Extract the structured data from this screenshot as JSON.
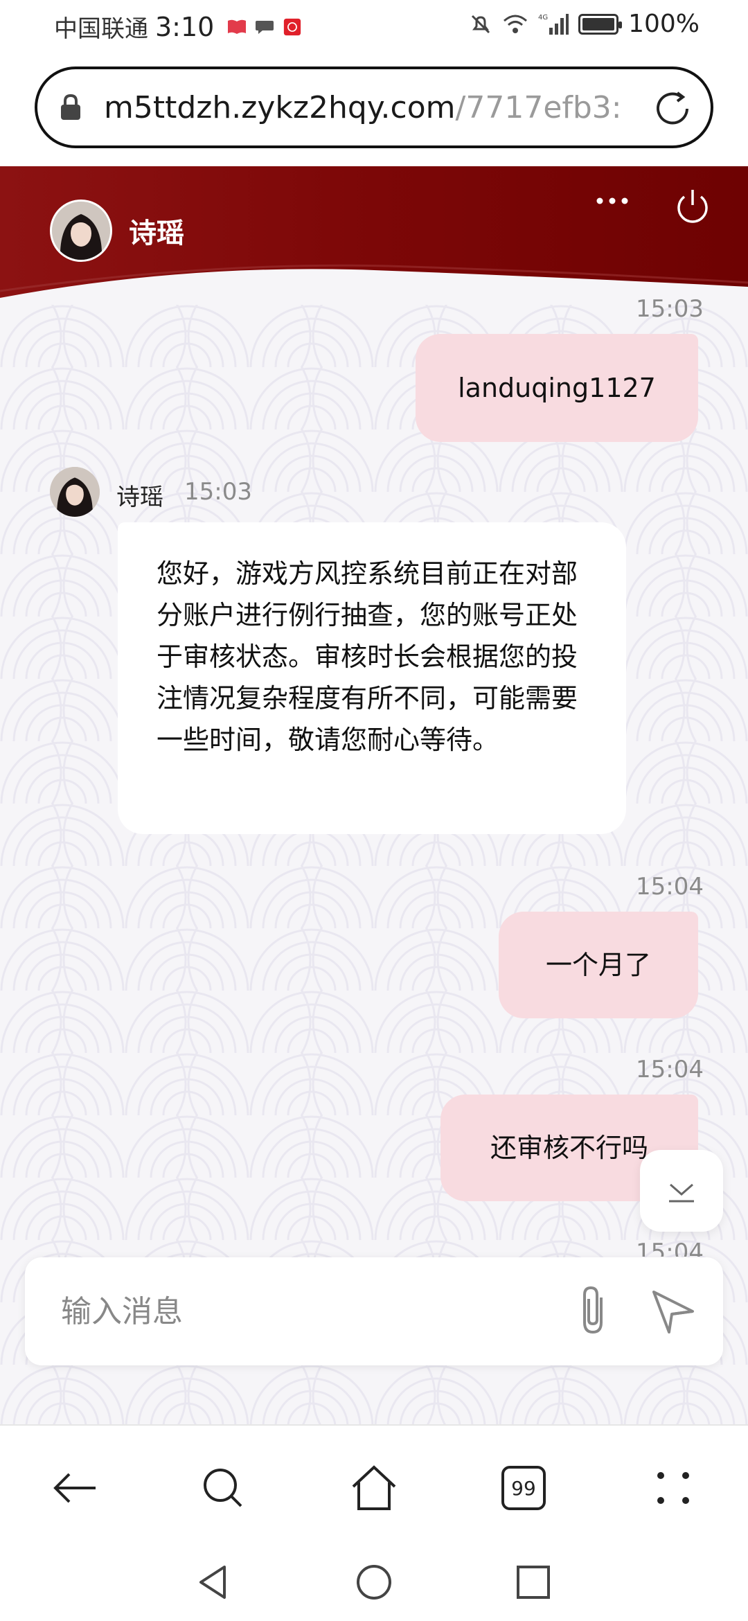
{
  "status_bar": {
    "carrier": "中国联通",
    "time": "3:10",
    "battery": "100%",
    "network": "4G"
  },
  "url_bar": {
    "host": "m5ttdzh.zykz2hqy.com",
    "path": "/7717efb3:"
  },
  "chat_header": {
    "contact_name": "诗瑶"
  },
  "messages": [
    {
      "side": "out",
      "time": "15:03",
      "text": "landuqing1127"
    },
    {
      "side": "in",
      "sender": "诗瑶",
      "time": "15:03",
      "text": "您好，游戏方风控系统目前正在对部分账户进行例行抽查，您的账号正处于审核状态。审核时长会根据您的投注情况复杂程度有所不同，可能需要一些时间，敬请您耐心等待。"
    },
    {
      "side": "out",
      "time": "15:04",
      "text": "一个月了"
    },
    {
      "side": "out",
      "time": "15:04",
      "text": "还审核不行吗"
    },
    {
      "side": "out",
      "time": "15:04",
      "text": ""
    }
  ],
  "input": {
    "placeholder": "输入消息"
  },
  "browser_nav": {
    "tabs_count": "99"
  },
  "colors": {
    "header_red": "#7c0707",
    "bubble_out": "#f8dbe0",
    "bubble_in": "#ffffff",
    "chat_bg": "#f6f5f8"
  },
  "icons": [
    "lock-icon",
    "reload-icon",
    "more-icon",
    "power-icon",
    "attach-icon",
    "send-icon",
    "scroll-down-icon",
    "back-icon",
    "search-icon",
    "home-icon",
    "tabs-icon",
    "menu-icon"
  ]
}
